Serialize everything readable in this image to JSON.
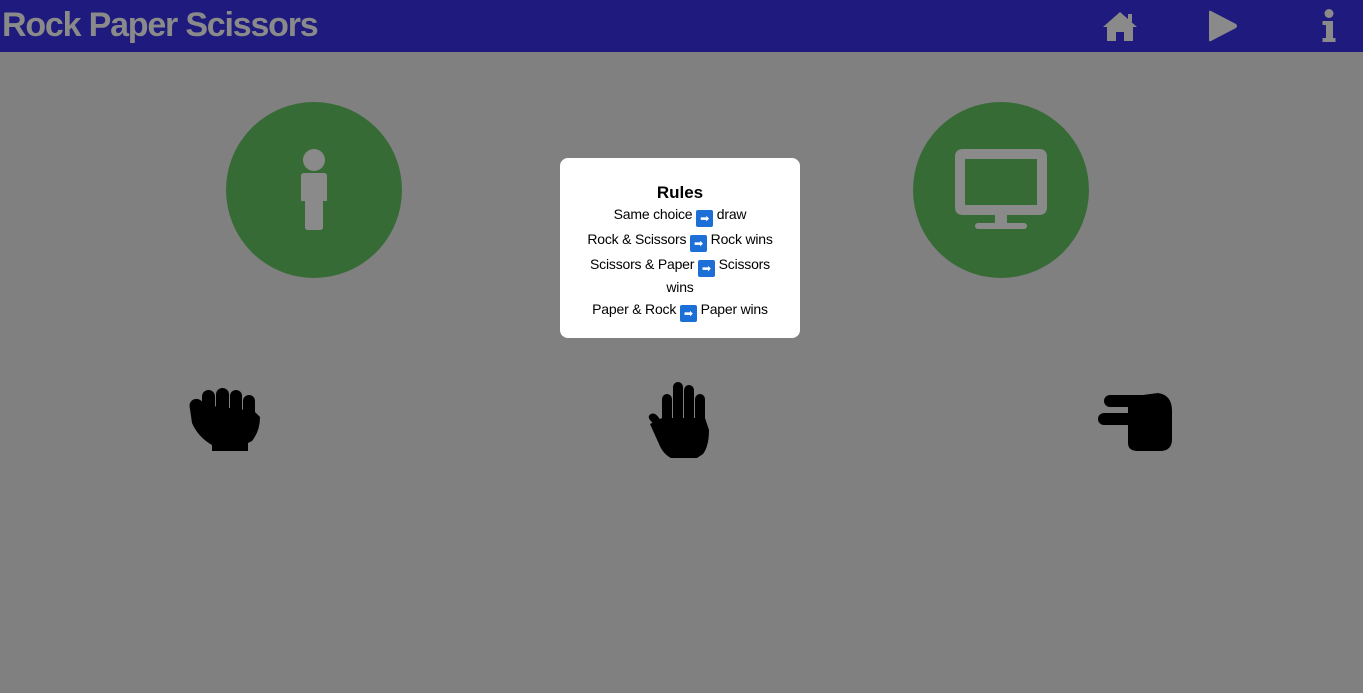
{
  "header": {
    "title": "Rock Paper Scissors",
    "nav": [
      {
        "name": "home",
        "icon": "home-icon"
      },
      {
        "name": "play",
        "icon": "play-icon"
      },
      {
        "name": "info",
        "icon": "info-icon"
      }
    ]
  },
  "players": {
    "player_icon": "person-icon",
    "computer_icon": "desktop-icon"
  },
  "choices": [
    {
      "name": "rock",
      "icon": "hand-rock-icon"
    },
    {
      "name": "paper",
      "icon": "hand-paper-icon"
    },
    {
      "name": "scissors",
      "icon": "hand-scissors-icon"
    }
  ],
  "rules": {
    "title": "Rules",
    "arrow_glyph": "➡",
    "items": [
      {
        "left": "Same choice",
        "right": "draw"
      },
      {
        "left": "Rock & Scissors",
        "right": "Rock wins"
      },
      {
        "left": "Scissors & Paper",
        "right": "Scissors wins"
      },
      {
        "left": "Paper & Rock",
        "right": "Paper wins"
      }
    ]
  },
  "colors": {
    "header_bg": "#1e1a7e",
    "page_bg": "#808080",
    "avatar_bg": "#366b36",
    "icon_gray": "#8a8a8a",
    "arrow_blue": "#1b6fd6"
  }
}
